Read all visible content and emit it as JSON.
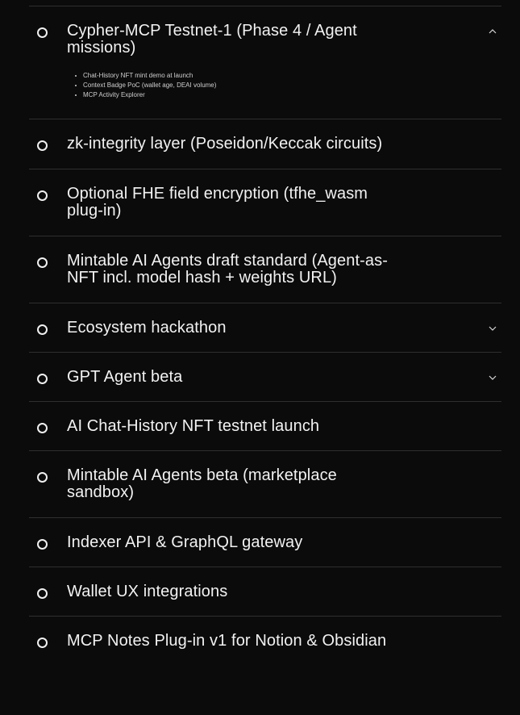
{
  "roadmap": {
    "items": [
      {
        "title": "Cypher-MCP Testnet-1 (Phase 4 / Agent missions)",
        "chevron": "chevron-up-icon",
        "sub_items": [
          "Chat-History NFT mint demo at launch",
          "Context Badge PoC (wallet age, DEAI volume)",
          "MCP Activity Explorer"
        ]
      },
      {
        "title": "zk-integrity layer (Poseidon/Keccak circuits)"
      },
      {
        "title": "Optional FHE field encryption (tfhe_wasm plug-in)"
      },
      {
        "title": "Mintable AI Agents draft standard (Agent-as-NFT incl. model hash + weights URL)"
      },
      {
        "title": "Ecosystem hackathon",
        "chevron": "chevron-down-icon"
      },
      {
        "title": "GPT Agent beta",
        "chevron": "chevron-down-icon"
      },
      {
        "title": "AI Chat-History NFT testnet launch"
      },
      {
        "title": "Mintable AI Agents beta (marketplace sandbox)"
      },
      {
        "title": "Indexer API & GraphQL gateway"
      },
      {
        "title": "Wallet UX integrations"
      },
      {
        "title": "MCP Notes Plug-in v1 for Notion & Obsidian"
      }
    ]
  }
}
